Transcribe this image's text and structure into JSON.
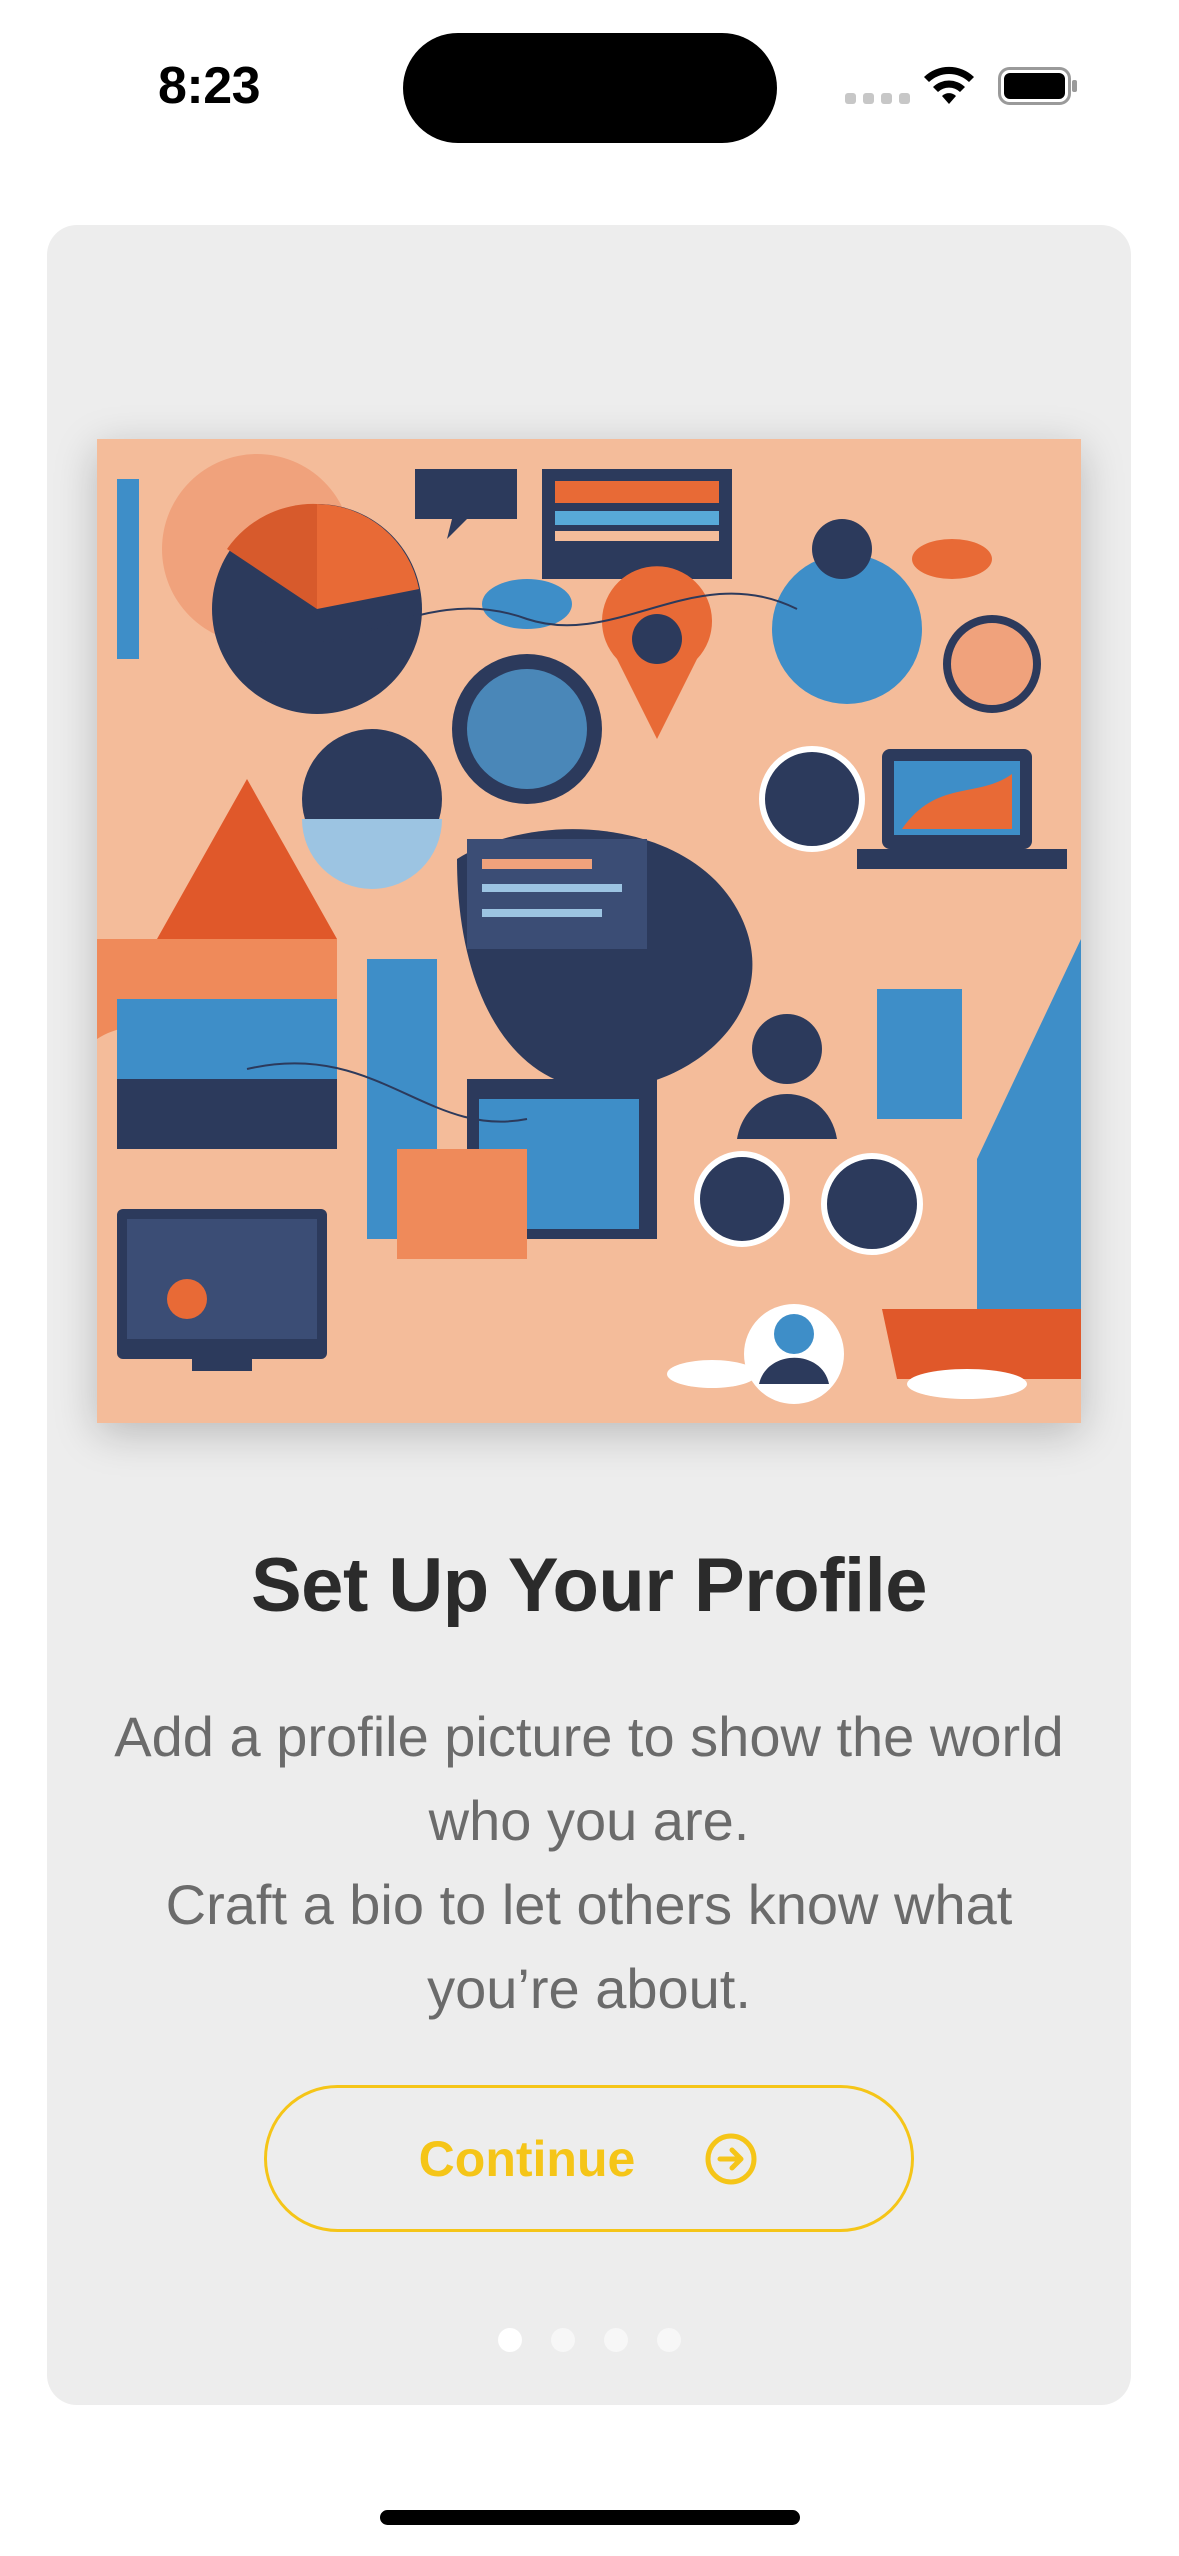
{
  "status_bar": {
    "time": "8:23",
    "icons": [
      "cellular-icon",
      "wifi-icon",
      "battery-icon"
    ]
  },
  "onboarding": {
    "illustration": "profile-setup-illustration",
    "title": "Set Up Your Profile",
    "description_lines": [
      "Add a profile picture to show the world who you are.",
      "Craft a bio to let others know what you’re about."
    ],
    "continue_label": "Continue",
    "continue_icon": "arrow-right-circle-icon",
    "page_indicator": {
      "current": 1,
      "total": 4
    }
  },
  "colors": {
    "accent": "#f5c518",
    "card_background": "#ededed",
    "title": "#2b2b2b",
    "body_text": "#6b6b6b"
  }
}
